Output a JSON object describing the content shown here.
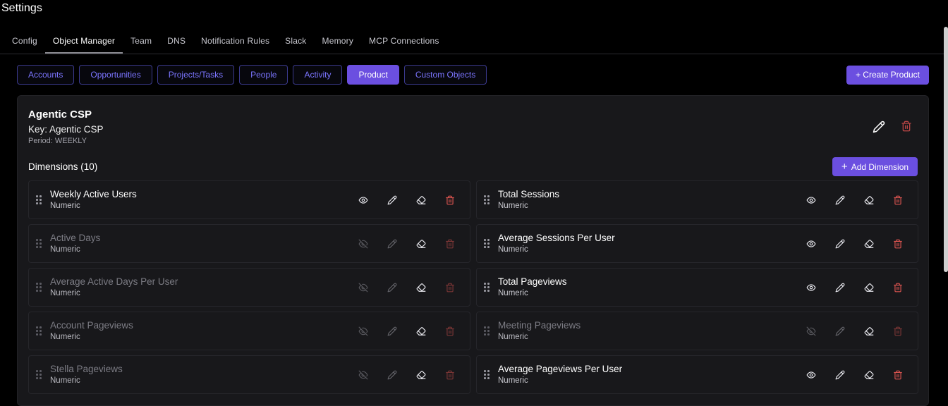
{
  "page": {
    "title": "Settings"
  },
  "tabs": [
    {
      "label": "Config",
      "active": false
    },
    {
      "label": "Object Manager",
      "active": true
    },
    {
      "label": "Team",
      "active": false
    },
    {
      "label": "DNS",
      "active": false
    },
    {
      "label": "Notification Rules",
      "active": false
    },
    {
      "label": "Slack",
      "active": false
    },
    {
      "label": "Memory",
      "active": false
    },
    {
      "label": "MCP Connections",
      "active": false
    }
  ],
  "object_tabs": [
    {
      "label": "Accounts",
      "active": false
    },
    {
      "label": "Opportunities",
      "active": false
    },
    {
      "label": "Projects/Tasks",
      "active": false
    },
    {
      "label": "People",
      "active": false
    },
    {
      "label": "Activity",
      "active": false
    },
    {
      "label": "Product",
      "active": true
    },
    {
      "label": "Custom Objects",
      "active": false
    }
  ],
  "create_button": "+ Create Product",
  "product": {
    "name": "Agentic CSP",
    "key_text": "Key: Agentic CSP",
    "period_text": "Period: WEEKLY"
  },
  "dimensions": {
    "title": "Dimensions (10)",
    "add_button": "Add Dimension",
    "add_icon": "+",
    "left": [
      {
        "name": "Weekly Active Users",
        "type": "Numeric",
        "visible": true
      },
      {
        "name": "Active Days",
        "type": "Numeric",
        "visible": false
      },
      {
        "name": "Average Active Days Per User",
        "type": "Numeric",
        "visible": false
      },
      {
        "name": "Account Pageviews",
        "type": "Numeric",
        "visible": false
      },
      {
        "name": "Stella Pageviews",
        "type": "Numeric",
        "visible": false
      }
    ],
    "right": [
      {
        "name": "Total Sessions",
        "type": "Numeric",
        "visible": true
      },
      {
        "name": "Average Sessions Per User",
        "type": "Numeric",
        "visible": true
      },
      {
        "name": "Total Pageviews",
        "type": "Numeric",
        "visible": true
      },
      {
        "name": "Meeting Pageviews",
        "type": "Numeric",
        "visible": false
      },
      {
        "name": "Average Pageviews Per User",
        "type": "Numeric",
        "visible": true
      }
    ]
  },
  "colors": {
    "accent": "#6b4fe0",
    "tab_text": "#7b75ff",
    "delete": "#d9534f"
  },
  "icons": {
    "edit": "pencil-icon",
    "delete": "trash-icon",
    "visible": "eye-icon",
    "hidden": "eye-off-icon",
    "clear": "eraser-icon",
    "drag": "drag-handle-icon"
  }
}
